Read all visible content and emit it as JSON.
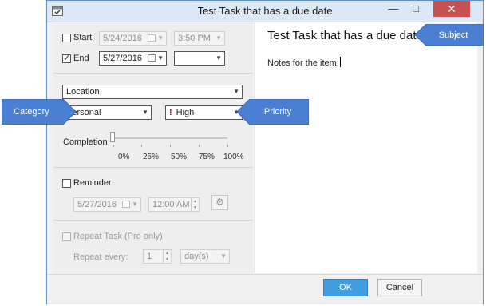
{
  "window": {
    "title": "Test Task that has a due date",
    "controls": {
      "minimize": "—",
      "maximize": "□",
      "close": "✕"
    }
  },
  "dates": {
    "start": {
      "label": "Start",
      "checked": false,
      "date": "5/24/2016",
      "time": "3:50 PM"
    },
    "end": {
      "label": "End",
      "checked": true,
      "date": "5/27/2016",
      "time": ""
    }
  },
  "location": {
    "value": "Location"
  },
  "category": {
    "value": "Personal"
  },
  "priority": {
    "value": "High",
    "mark": "!"
  },
  "completion": {
    "label": "Completion",
    "value": 0,
    "ticks": [
      "0%",
      "25%",
      "50%",
      "75%",
      "100%"
    ]
  },
  "reminder": {
    "label": "Reminder",
    "checked": false,
    "date": "5/27/2016",
    "time": "12:00 AM",
    "settings_icon": "gear-icon"
  },
  "repeat": {
    "label": "Repeat Task (Pro only)",
    "every_label": "Repeat every:",
    "interval": "1",
    "unit": "day(s)"
  },
  "subject": "Test Task that has a due date",
  "notes": "Notes for the item.",
  "buttons": {
    "ok": "OK",
    "cancel": "Cancel"
  },
  "callouts": {
    "subject": "Subject",
    "category": "Category",
    "priority": "Priority"
  },
  "colors": {
    "accent": "#3f9de0",
    "callout": "#4a7fd4",
    "close": "#c75050",
    "priority_mark": "#d00000"
  }
}
